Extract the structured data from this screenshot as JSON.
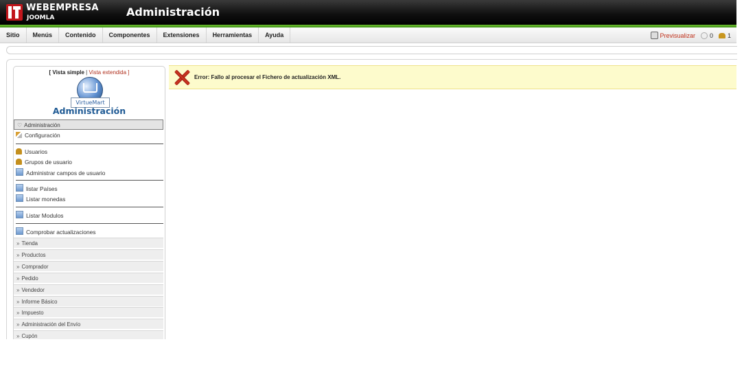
{
  "header": {
    "brand": "WEBEMPRESA",
    "brand_sub": "JOOMLA",
    "title": "Administración"
  },
  "menubar": {
    "items": [
      "Sitio",
      "Menús",
      "Contenido",
      "Componentes",
      "Extensiones",
      "Herramientas",
      "Ayuda"
    ],
    "preview": "Previsualizar",
    "messages": "0",
    "users_online": "1"
  },
  "sidebar": {
    "vista_simple": "[ Vista simple",
    "sep": "|",
    "vista_extendida": "Vista extendida ]",
    "logo_text": "VirtueMart",
    "title": "Administración",
    "active_section": "Administración",
    "links": {
      "configuracion": "Configuración",
      "usuarios": "Usuarios",
      "grupos": "Grupos de usuario",
      "campos": "Administrar campos de usuario",
      "paises": "listar Países",
      "monedas": "Listar monedas",
      "modulos": "Listar Modulos",
      "actualizaciones": "Comprobar actualizaciones"
    },
    "sections": [
      "Tienda",
      "Productos",
      "Comprador",
      "Pedido",
      "Vendedor",
      "Informe Básico",
      "Impuesto",
      "Administración del Envío",
      "Cupón"
    ]
  },
  "error": {
    "message": "Error: Fallo al procesar el Fichero de actualización XML."
  }
}
